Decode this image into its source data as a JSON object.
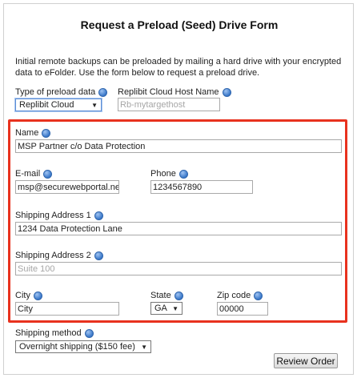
{
  "form": {
    "title": "Request a Preload (Seed) Drive Form",
    "intro": "Initial remote backups can be preloaded by mailing a hard drive with your encrypted data to eFolder. Use the form below to request a preload drive.",
    "preload_type": {
      "label": "Type of preload data",
      "value": "Replibit Cloud"
    },
    "host_name": {
      "label": "Replibit Cloud Host Name",
      "placeholder": "Rb-mytargethost"
    },
    "name": {
      "label": "Name",
      "value": "MSP Partner c/o Data Protection"
    },
    "email": {
      "label": "E-mail",
      "value": "msp@securewebportal.ne"
    },
    "phone": {
      "label": "Phone",
      "value": "1234567890"
    },
    "address1": {
      "label": "Shipping Address 1",
      "value": "1234 Data Protection Lane"
    },
    "address2": {
      "label": "Shipping Address 2",
      "placeholder": "Suite 100"
    },
    "city": {
      "label": "City",
      "value": "City"
    },
    "state": {
      "label": "State",
      "value": "GA"
    },
    "zip": {
      "label": "Zip code",
      "value": "00000"
    },
    "shipping_method": {
      "label": "Shipping method",
      "value": "Overnight shipping ($150 fee)"
    },
    "review_button": "Review Order"
  },
  "colors": {
    "highlight_border": "#e8321e",
    "help_icon": "#3a78c9"
  },
  "icons": {
    "help": "help-icon"
  }
}
